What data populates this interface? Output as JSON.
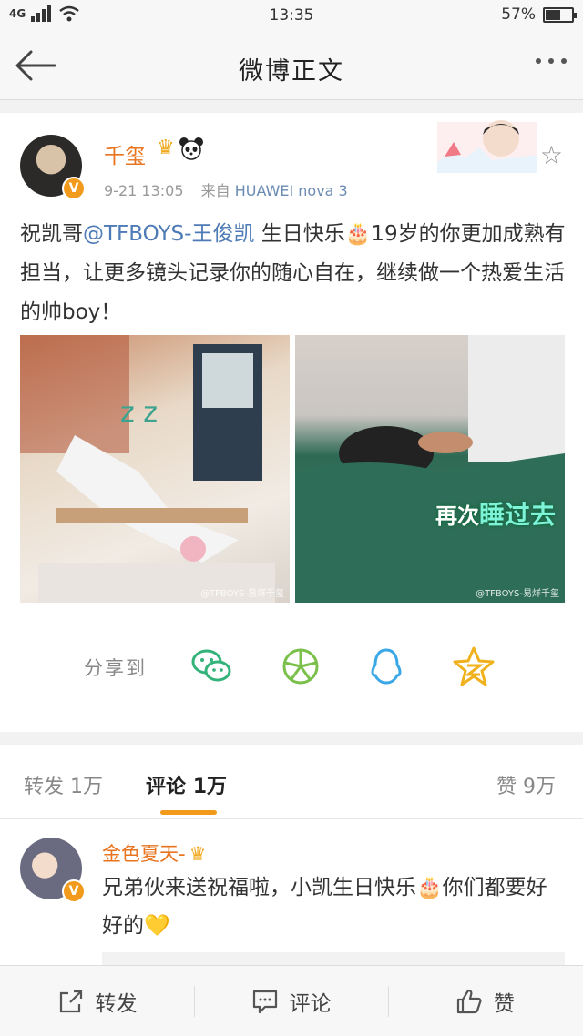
{
  "status_bar": {
    "network": "4G",
    "time": "13:35",
    "battery": "57%",
    "battery_level": 0.57
  },
  "nav": {
    "title": "微博正文"
  },
  "post": {
    "username": "千玺",
    "badge_crown_icon": "crown-icon",
    "badge_panda_icon": "panda-icon",
    "verified_mark": "V",
    "time": "9-21 13:05",
    "source_prefix": "来自",
    "source": "HUAWEI nova 3",
    "text_part1": "祝凯哥",
    "mention": "@TFBOYS-王俊凯",
    "text_part2": " 生日快乐🎂19岁的你更加成熟有担当，让更多镜头记录你的随心自在，继续做一个热爱生活的帅boy！",
    "photo1_watermark": "@TFBOYS-易烊千玺",
    "photo2_caption_prefix": "再次",
    "photo2_caption": "睡过去",
    "photo2_watermark": "@TFBOYS-易烊千玺"
  },
  "share": {
    "label": "分享到",
    "icons": [
      "wechat-icon",
      "moments-icon",
      "qq-icon",
      "qzone-icon"
    ]
  },
  "tabs": {
    "repost": "转发",
    "repost_count": "1万",
    "comment": "评论",
    "comment_count": "1万",
    "like": "赞",
    "like_count": "9万"
  },
  "comment": {
    "username": "金色夏天-",
    "text": "兄弟伙来送祝福啦，小凯生日快乐🎂你们都要好好的💛"
  },
  "bottom_bar": {
    "repost": "转发",
    "comment": "评论",
    "like": "赞"
  },
  "colors": {
    "accent": "#f29a1b",
    "username": "#e8741f",
    "link": "#4e7ab5"
  }
}
